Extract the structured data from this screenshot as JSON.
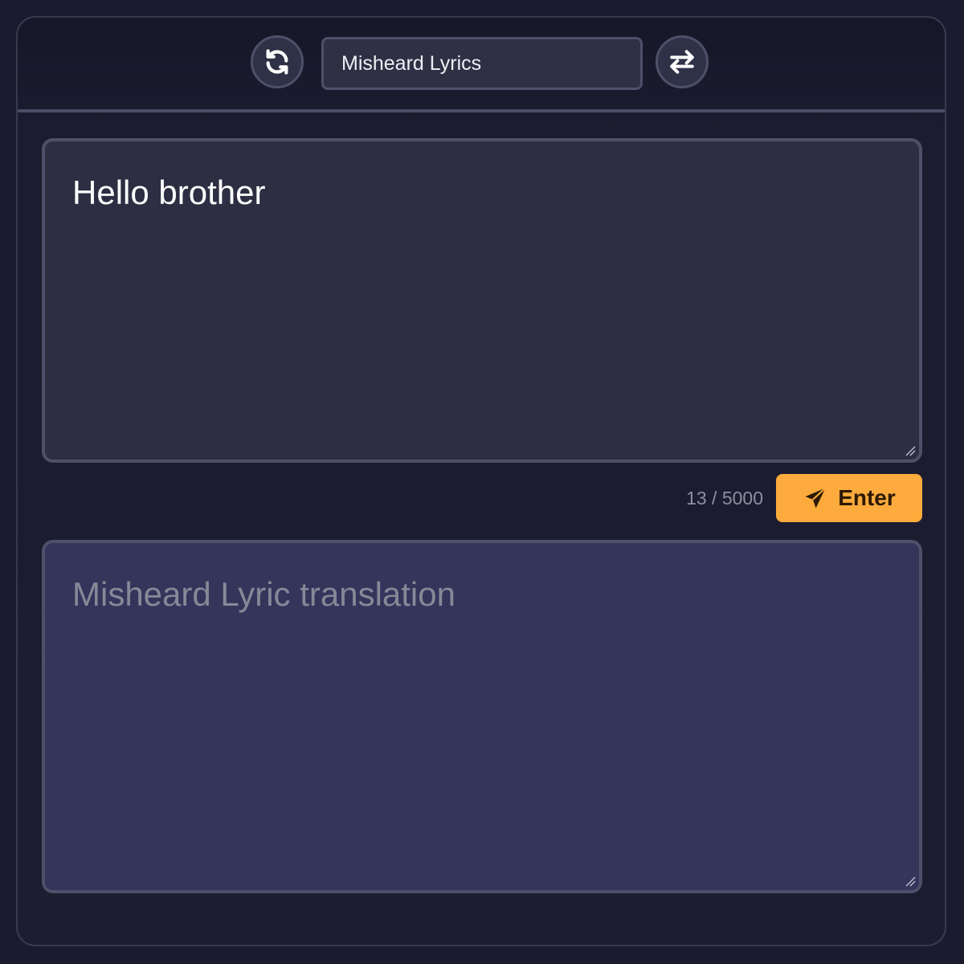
{
  "toolbar": {
    "refresh_icon": "refresh-icon",
    "mode_label": "Misheard Lyrics",
    "swap_icon": "swap-arrows-icon"
  },
  "input": {
    "value": "Hello brother",
    "char_count": "13 / 5000"
  },
  "actions": {
    "enter_label": "Enter",
    "enter_icon": "paper-plane-icon"
  },
  "output": {
    "placeholder": "Misheard Lyric translation"
  },
  "colors": {
    "accent": "#fdab3d",
    "background": "#1a1b2e",
    "output_bg": "#34355b"
  }
}
